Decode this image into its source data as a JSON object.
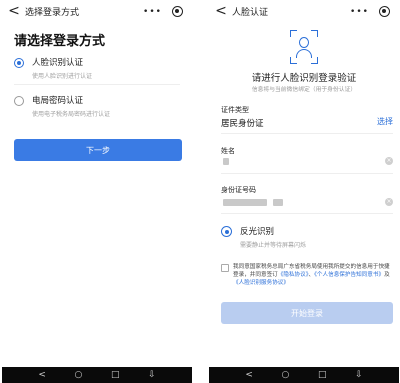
{
  "nav": {
    "back": "<",
    "back2": "<",
    "home": "○",
    "recent": "□",
    "down": "⇩"
  },
  "left": {
    "title": "选择登录方式",
    "heading": "请选择登录方式",
    "options": [
      {
        "label": "人脸识别认证",
        "desc": "使用人脸识别进行认证",
        "selected": true
      },
      {
        "label": "电局密码认证",
        "desc": "使用电子税务局密码进行认证",
        "selected": false
      }
    ],
    "next_button": "下一步"
  },
  "right": {
    "title": "人脸认证",
    "heading": "请进行人脸识别登录验证",
    "subheading": "信息将与当前微信绑定（用于身份认证）",
    "id_type_label": "证件类型",
    "id_type_value": "居民身份证",
    "select_link": "选择",
    "name_label": "姓名",
    "id_number_label": "身份证号码",
    "mode_label": "反光识别",
    "mode_desc": "需要静止并等待屏幕闪烁",
    "agreement": {
      "prefix": "我同意国家税务总局广东省税务局使用我所提交的信息用于快捷登录，并同意签订",
      "link1": "《隐私协议》",
      "sep1": "、",
      "link2": "《个人信息保护告知同意书》",
      "and": "及",
      "link3": "《人脸识别服务协议》"
    },
    "start_button": "开始登录"
  },
  "colors": {
    "accent": "#3a7be4",
    "disabled": "#b9cdf0",
    "navbar": "#0a0a0a"
  }
}
